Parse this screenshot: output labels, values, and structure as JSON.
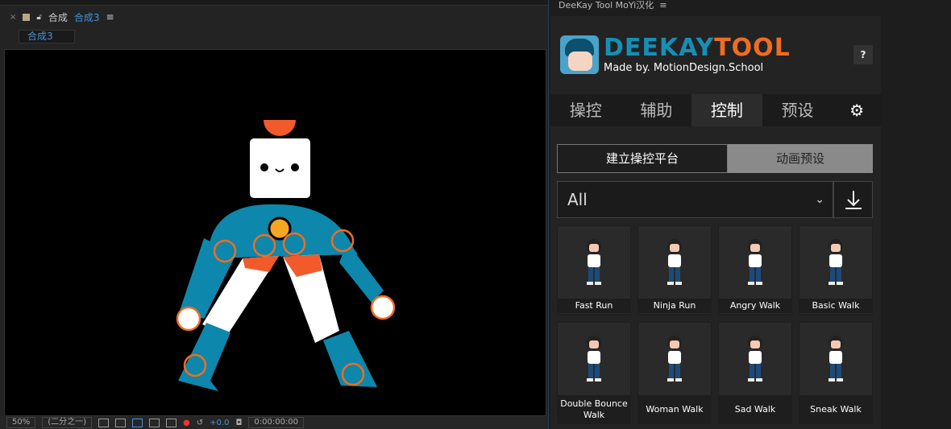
{
  "composition_panel": {
    "close": "×",
    "title": "合成",
    "comp_name": "合成3",
    "menu": "≡",
    "tab_label": "合成3"
  },
  "viewer_toolbar": {
    "zoom": "50%",
    "resolution": "(二分之一)",
    "exposure": "+0.0",
    "timecode": "0:00:00:00"
  },
  "deekay": {
    "panel_title": "DeeKay Tool MoYi汉化",
    "menu": "≡",
    "logo_text_1": "DEEKAY",
    "logo_text_2": "TOOL",
    "logo_subtitle": "Made by. MotionDesign.School",
    "help": "?",
    "tabs": [
      {
        "label": "操控"
      },
      {
        "label": "辅助"
      },
      {
        "label": "控制",
        "active": true
      },
      {
        "label": "预设"
      }
    ],
    "gear": "⚙",
    "segment": {
      "left": "建立操控平台",
      "right": "动画预设"
    },
    "dropdown": {
      "value": "All",
      "chevron": "⌄"
    },
    "presets": [
      {
        "label": "Fast Run"
      },
      {
        "label": "Ninja Run"
      },
      {
        "label": "Angry Walk"
      },
      {
        "label": "Basic Walk"
      },
      {
        "label": "Double Bounce Walk"
      },
      {
        "label": "Woman Walk"
      },
      {
        "label": "Sad Walk"
      },
      {
        "label": "Sneak Walk"
      }
    ],
    "colors": {
      "blue": "#168fb6",
      "orange": "#ee6d22"
    }
  }
}
